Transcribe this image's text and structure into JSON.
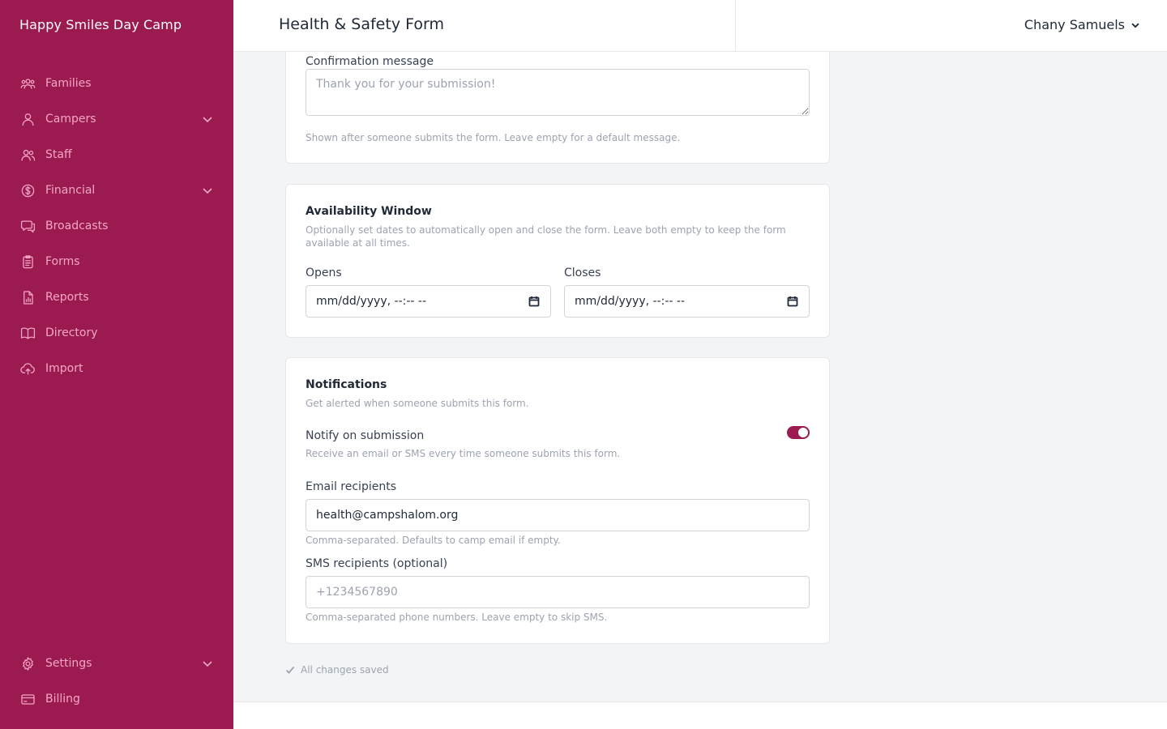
{
  "app": {
    "brand": "Happy Smiles Day Camp"
  },
  "sidebar": {
    "items": [
      {
        "label": "Families",
        "icon": "users-group-icon",
        "expandable": false
      },
      {
        "label": "Campers",
        "icon": "user-icon",
        "expandable": true
      },
      {
        "label": "Staff",
        "icon": "users-icon",
        "expandable": false
      },
      {
        "label": "Financial",
        "icon": "dollar-circle-icon",
        "expandable": true
      },
      {
        "label": "Broadcasts",
        "icon": "chat-icon",
        "expandable": false
      },
      {
        "label": "Forms",
        "icon": "clipboard-icon",
        "expandable": false
      },
      {
        "label": "Reports",
        "icon": "report-icon",
        "expandable": false
      },
      {
        "label": "Directory",
        "icon": "book-icon",
        "expandable": false
      },
      {
        "label": "Import",
        "icon": "cloud-upload-icon",
        "expandable": false
      }
    ],
    "bottom_items": [
      {
        "label": "Settings",
        "icon": "gear-icon",
        "expandable": true
      },
      {
        "label": "Billing",
        "icon": "credit-card-icon",
        "expandable": false
      }
    ]
  },
  "header": {
    "title": "Health & Safety Form",
    "user_name": "Chany Samuels"
  },
  "confirmation": {
    "label": "Confirmation message",
    "placeholder": "Thank you for your submission!",
    "value": "",
    "hint": "Shown after someone submits the form. Leave empty for a default message."
  },
  "availability": {
    "title": "Availability Window",
    "description": "Optionally set dates to automatically open and close the form. Leave both empty to keep the form available at all times.",
    "opens_label": "Opens",
    "opens_value": "mm/dd/yyyy, --:-- --",
    "closes_label": "Closes",
    "closes_value": "mm/dd/yyyy, --:-- --"
  },
  "notifications": {
    "title": "Notifications",
    "description": "Get alerted when someone submits this form.",
    "notify_label": "Notify on submission",
    "notify_desc": "Receive an email or SMS every time someone submits this form.",
    "notify_enabled": true,
    "email_label": "Email recipients",
    "email_value": "health@campshalom.org",
    "email_hint": "Comma-separated. Defaults to camp email if empty.",
    "sms_label": "SMS recipients (optional)",
    "sms_placeholder": "+1234567890",
    "sms_value": "",
    "sms_hint": "Comma-separated phone numbers. Leave empty to skip SMS."
  },
  "status": {
    "saved_text": "All changes saved"
  },
  "colors": {
    "brand": "#9b1a4f",
    "nav_text": "#f6a7c8",
    "background": "#f3f4f6"
  }
}
